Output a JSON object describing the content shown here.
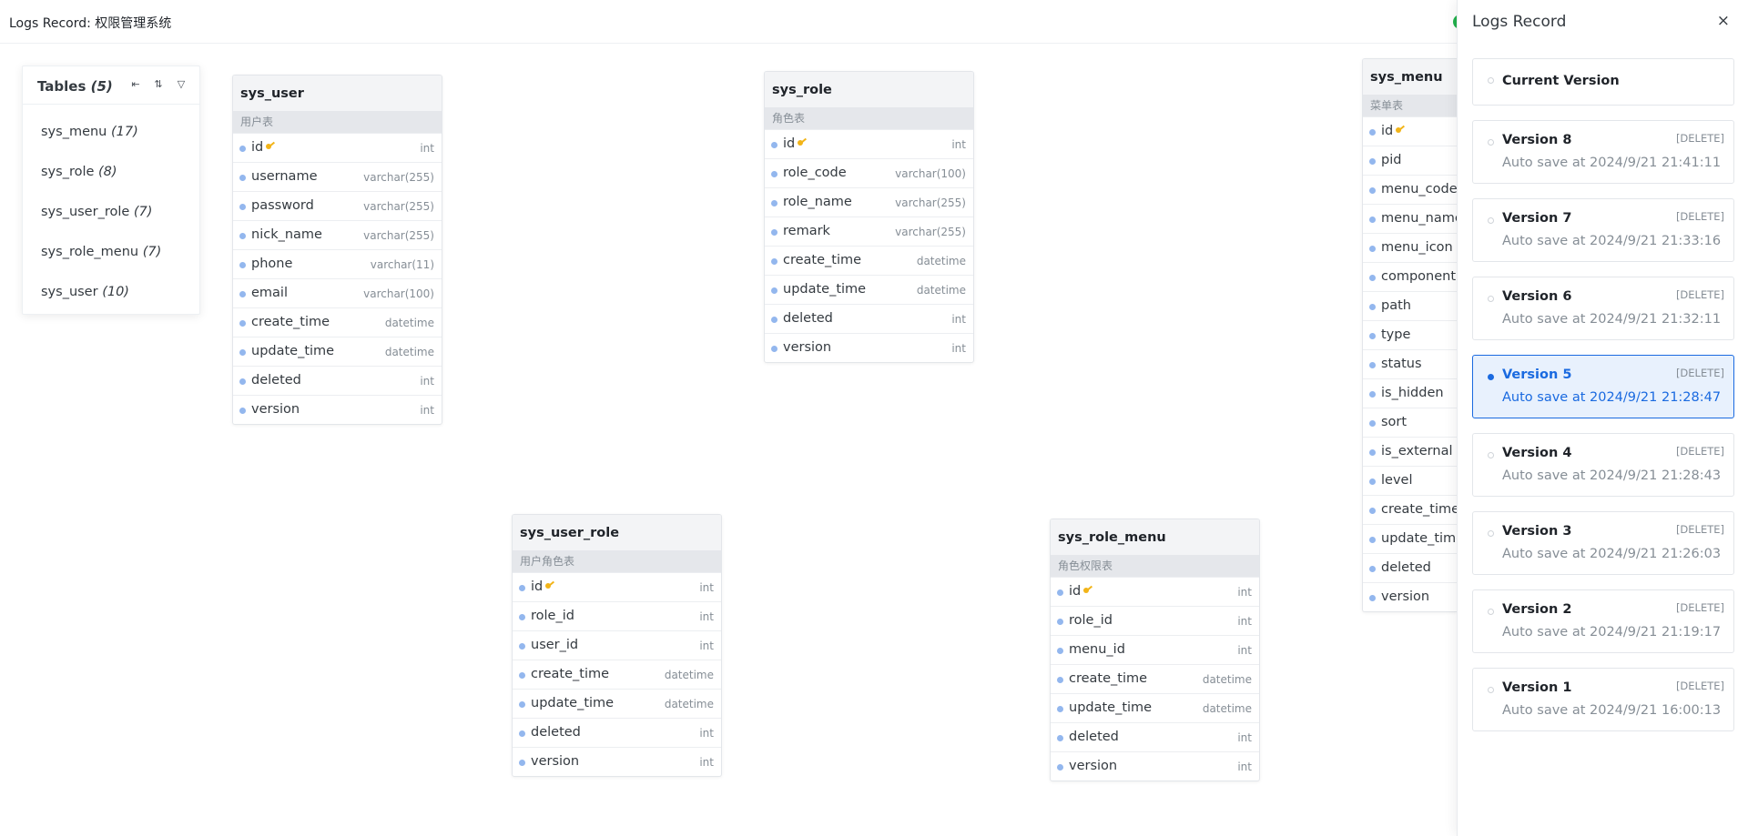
{
  "header": {
    "title": "Logs Record: 权限管理系统"
  },
  "tables_panel": {
    "title": "Tables",
    "count": "(5)",
    "tool_icons": [
      "collapse-left-icon",
      "sort-icon",
      "filter-icon"
    ],
    "items": [
      {
        "name": "sys_menu",
        "count": "(17)"
      },
      {
        "name": "sys_role",
        "count": "(8)"
      },
      {
        "name": "sys_user_role",
        "count": "(7)"
      },
      {
        "name": "sys_role_menu",
        "count": "(7)"
      },
      {
        "name": "sys_user",
        "count": "(10)"
      }
    ]
  },
  "tables": {
    "sys_user": {
      "name": "sys_user",
      "comment": "用户表",
      "fields": [
        {
          "name": "id",
          "type": "int",
          "pk": true
        },
        {
          "name": "username",
          "type": "varchar(255)"
        },
        {
          "name": "password",
          "type": "varchar(255)"
        },
        {
          "name": "nick_name",
          "type": "varchar(255)"
        },
        {
          "name": "phone",
          "type": "varchar(11)"
        },
        {
          "name": "email",
          "type": "varchar(100)"
        },
        {
          "name": "create_time",
          "type": "datetime"
        },
        {
          "name": "update_time",
          "type": "datetime"
        },
        {
          "name": "deleted",
          "type": "int"
        },
        {
          "name": "version",
          "type": "int"
        }
      ]
    },
    "sys_role": {
      "name": "sys_role",
      "comment": "角色表",
      "fields": [
        {
          "name": "id",
          "type": "int",
          "pk": true
        },
        {
          "name": "role_code",
          "type": "varchar(100)"
        },
        {
          "name": "role_name",
          "type": "varchar(255)"
        },
        {
          "name": "remark",
          "type": "varchar(255)"
        },
        {
          "name": "create_time",
          "type": "datetime"
        },
        {
          "name": "update_time",
          "type": "datetime"
        },
        {
          "name": "deleted",
          "type": "int"
        },
        {
          "name": "version",
          "type": "int"
        }
      ]
    },
    "sys_menu": {
      "name": "sys_menu",
      "comment": "菜单表",
      "fields": [
        {
          "name": "id",
          "type": "",
          "pk": true
        },
        {
          "name": "pid",
          "type": ""
        },
        {
          "name": "menu_code",
          "type": ""
        },
        {
          "name": "menu_name",
          "type": ""
        },
        {
          "name": "menu_icon",
          "type": ""
        },
        {
          "name": "component",
          "type": ""
        },
        {
          "name": "path",
          "type": ""
        },
        {
          "name": "type",
          "type": ""
        },
        {
          "name": "status",
          "type": ""
        },
        {
          "name": "is_hidden",
          "type": ""
        },
        {
          "name": "sort",
          "type": ""
        },
        {
          "name": "is_external",
          "type": ""
        },
        {
          "name": "level",
          "type": ""
        },
        {
          "name": "create_time",
          "type": ""
        },
        {
          "name": "update_time",
          "type": ""
        },
        {
          "name": "deleted",
          "type": ""
        },
        {
          "name": "version",
          "type": ""
        }
      ]
    },
    "sys_user_role": {
      "name": "sys_user_role",
      "comment": "用户角色表",
      "fields": [
        {
          "name": "id",
          "type": "int",
          "pk": true
        },
        {
          "name": "role_id",
          "type": "int"
        },
        {
          "name": "user_id",
          "type": "int"
        },
        {
          "name": "create_time",
          "type": "datetime"
        },
        {
          "name": "update_time",
          "type": "datetime"
        },
        {
          "name": "deleted",
          "type": "int"
        },
        {
          "name": "version",
          "type": "int"
        }
      ]
    },
    "sys_role_menu": {
      "name": "sys_role_menu",
      "comment": "角色权限表",
      "fields": [
        {
          "name": "id",
          "type": "int",
          "pk": true
        },
        {
          "name": "role_id",
          "type": "int"
        },
        {
          "name": "menu_id",
          "type": "int"
        },
        {
          "name": "create_time",
          "type": "datetime"
        },
        {
          "name": "update_time",
          "type": "datetime"
        },
        {
          "name": "deleted",
          "type": "int"
        },
        {
          "name": "version",
          "type": "int"
        }
      ]
    }
  },
  "drawer": {
    "title": "Logs Record",
    "close_label": "×",
    "versions": [
      {
        "title": "Current Version",
        "tag": "",
        "subtitle": "",
        "active": false
      },
      {
        "title": "Version 8",
        "tag": "[DELETE]",
        "subtitle": "Auto save at 2024/9/21 21:41:11",
        "active": false
      },
      {
        "title": "Version 7",
        "tag": "[DELETE]",
        "subtitle": "Auto save at 2024/9/21 21:33:16",
        "active": false
      },
      {
        "title": "Version 6",
        "tag": "[DELETE]",
        "subtitle": "Auto save at 2024/9/21 21:32:11",
        "active": false
      },
      {
        "title": "Version 5",
        "tag": "[DELETE]",
        "subtitle": "Auto save at 2024/9/21 21:28:47",
        "active": true
      },
      {
        "title": "Version 4",
        "tag": "[DELETE]",
        "subtitle": "Auto save at 2024/9/21 21:28:43",
        "active": false
      },
      {
        "title": "Version 3",
        "tag": "[DELETE]",
        "subtitle": "Auto save at 2024/9/21 21:26:03",
        "active": false
      },
      {
        "title": "Version 2",
        "tag": "[DELETE]",
        "subtitle": "Auto save at 2024/9/21 21:19:17",
        "active": false
      },
      {
        "title": "Version 1",
        "tag": "[DELETE]",
        "subtitle": "Auto save at 2024/9/21 16:00:13",
        "active": false
      }
    ]
  }
}
